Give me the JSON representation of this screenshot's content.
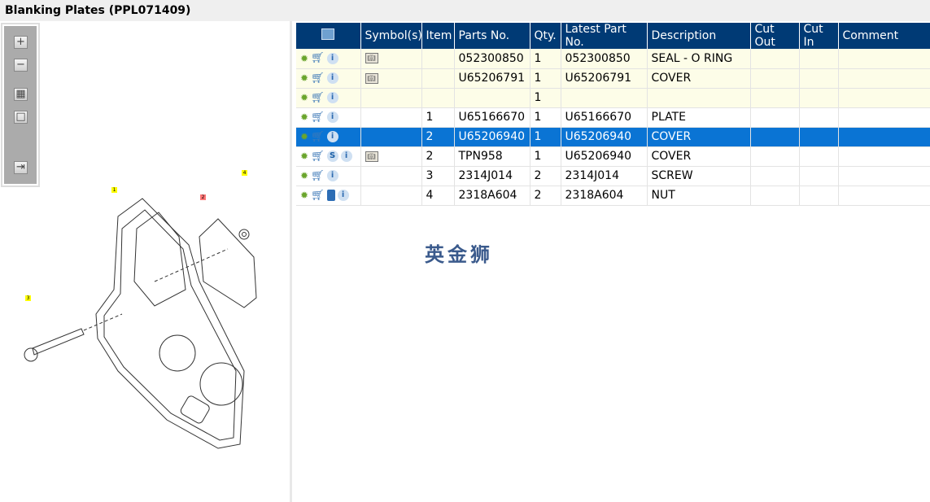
{
  "title": "Blanking Plates (PPL071409)",
  "toolbar": {
    "zoom_in": "+",
    "zoom_out": "−",
    "fit": "▦",
    "reset": "□",
    "export": "⇥"
  },
  "columns": [
    "",
    "Symbol(s)",
    "Item",
    "Parts No.",
    "Qty.",
    "Latest Part No.",
    "Description",
    "Cut Out",
    "Cut In",
    "Comment"
  ],
  "rows": [
    {
      "icons": [
        "gear",
        "cart",
        "info"
      ],
      "symbol": "book",
      "item": "",
      "part": "052300850",
      "qty": "1",
      "latest": "052300850",
      "desc": "SEAL - O RING",
      "style": "y"
    },
    {
      "icons": [
        "gear",
        "cart",
        "info"
      ],
      "symbol": "book",
      "item": "",
      "part": "U65206791",
      "qty": "1",
      "latest": "U65206791",
      "desc": "COVER",
      "style": "y"
    },
    {
      "icons": [
        "gear",
        "cart",
        "info"
      ],
      "symbol": "",
      "item": "",
      "part": "",
      "qty": "1",
      "latest": "",
      "desc": "",
      "style": "y"
    },
    {
      "icons": [
        "gear",
        "cart",
        "info"
      ],
      "symbol": "",
      "item": "1",
      "part": "U65166670",
      "qty": "1",
      "latest": "U65166670",
      "desc": "PLATE",
      "style": ""
    },
    {
      "icons": [
        "gear",
        "cart",
        "info"
      ],
      "symbol": "",
      "item": "2",
      "part": "U65206940",
      "qty": "1",
      "latest": "U65206940",
      "desc": "COVER",
      "style": "sel"
    },
    {
      "icons": [
        "gear",
        "cart",
        "s",
        "info"
      ],
      "symbol": "book",
      "item": "2",
      "part": "TPN958",
      "qty": "1",
      "latest": "U65206940",
      "desc": "COVER",
      "style": ""
    },
    {
      "icons": [
        "gear",
        "cart",
        "info"
      ],
      "symbol": "",
      "item": "3",
      "part": "2314J014",
      "qty": "2",
      "latest": "2314J014",
      "desc": "SCREW",
      "style": ""
    },
    {
      "icons": [
        "gear",
        "cart",
        "book",
        "info"
      ],
      "symbol": "",
      "item": "4",
      "part": "2318A604",
      "qty": "2",
      "latest": "2318A604",
      "desc": "NUT",
      "style": ""
    }
  ],
  "watermark": "英金狮",
  "callouts": [
    "1",
    "2",
    "3",
    "4"
  ],
  "colors": {
    "header": "#003a75",
    "selected": "#0a74d4",
    "highlight": "#fdfde8"
  }
}
